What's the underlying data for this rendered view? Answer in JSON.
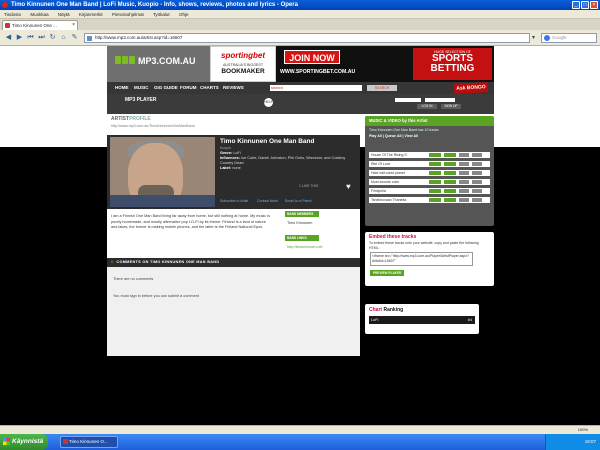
{
  "window": {
    "title": "Timo Kinnunen One Man Band | LoFi Music, Kuopio - Info, shows, reviews, photos and lyrics - Opera"
  },
  "menu": [
    "Tiedosto",
    "Muokkaa",
    "Näytä",
    "Kirjanmerkit",
    "Pienoisohjelmat",
    "Työkalut",
    "Ohje"
  ],
  "tab": {
    "label": "Timo Kinnunen One ..."
  },
  "address": {
    "url": "http://www.mp3.com.au/artist.asp?id=16607"
  },
  "browser_search": {
    "placeholder": "Google"
  },
  "site": {
    "logo": "MP3.COM.AU",
    "banner_left": {
      "brand": "sportingbet",
      "line1": "AUSTRALIA'S BIGGEST",
      "line2": "BOOKMAKER"
    },
    "banner_right": {
      "join": "JOIN NOW",
      "url": "WWW.SPORTINGBET.COM.AU",
      "small": "HUGE SELECTION OF",
      "big1": "SPORTS",
      "big2": "BETTING"
    },
    "nav": [
      "HOME",
      "MUSIC",
      "GIG GUIDE",
      "FORUM",
      "CHARTS",
      "REVIEWS"
    ],
    "site_search_value": "search",
    "search_button": "SEARCH",
    "bingo": "Ask BONGO",
    "player_label": "MP3 PLAYER",
    "help": "HELP",
    "login": "LOG IN",
    "signup": "SIGN UP"
  },
  "profile": {
    "header_prefix": "ARTIST",
    "header_suffix": "PROFILE",
    "url": "http://www.mp3.com.au/TimoKinnunenOneManBand",
    "band_name": "Timo Kinnunen One Man Band",
    "location": "Kuopio",
    "genre_label": "Genre:",
    "genre": "LoFi",
    "influences_label": "Influences:",
    "influences": "Ice Cube, Daniel Johnston, Phil Ochs, Wreckum, and Cowboy Country Dead",
    "label_label": "Label:",
    "label": "none",
    "likes": "1 LIKE THIS",
    "heart": "♥",
    "subscribe": "Subscribe to Artist",
    "contact": "Contact Artist",
    "email_friend": "Email to a Friend",
    "bio": "I am a Finnish One Man Band living far away from home, but still nothing at home. My music is purely homemade, and mostly alternative pop LO-FI by its theme. Finland is a land of nature and lakes, the former is making mobile phones, and the latter is the Finland National Epos.",
    "band_members_label": "BAND MEMBERS",
    "member": "Timo Kinnunen",
    "band_links_label": "BAND LINKS",
    "link": "http://timokinnunen.net"
  },
  "comments": {
    "count": "0",
    "header": "COMMENTS ON TIMO KINNUNEN ONE MAN BAND",
    "none": "There are no comments",
    "must_login": "You must sign in before you can submit a comment"
  },
  "music": {
    "header": "MUSIC & VIDEO by this Artist",
    "subtitle": "Timo Kinnunen One Man Band has 10 tracks",
    "play_all": "Play All | Queue All | View All",
    "tracks": [
      "House Of The Rising S",
      "Rite Of Love",
      "Hate half-sized planet",
      "Most sounds color",
      "Filmijuhla",
      "Tshekhovaan Thanetta"
    ]
  },
  "embed": {
    "title": "Embed these tracks",
    "text": "To embed these tracks onto your website, copy and paste the following HTML:",
    "code": "<iframe src=\"http://www.mp3.com.au/Player/ArtistPlayer.aspx?ArtistId=16607\"",
    "preview": "PREVIEW PLAYER"
  },
  "chart": {
    "title_a": "Chart",
    "title_b": "Ranking",
    "genre": "LoFi",
    "rank": "#4"
  },
  "statusbar": {
    "zoom": "100%"
  },
  "taskbar": {
    "start": "Käynnistä",
    "task": "Timo Kinnunen O...",
    "clock": "19:07"
  }
}
